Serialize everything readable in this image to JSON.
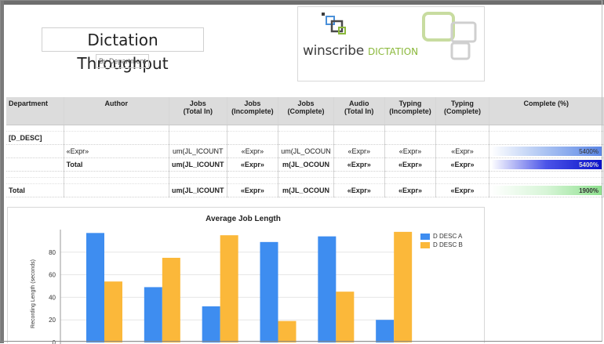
{
  "report": {
    "title": "Dictation Throughput",
    "subtitle": "By Department"
  },
  "logo": {
    "name": "winscribe",
    "tagline": "DICTATION"
  },
  "table": {
    "headers": [
      {
        "l1": "Department",
        "l2": ""
      },
      {
        "l1": "Author",
        "l2": ""
      },
      {
        "l1": "Jobs",
        "l2": "(Total In)"
      },
      {
        "l1": "Jobs",
        "l2": "(Incomplete)"
      },
      {
        "l1": "Jobs",
        "l2": "(Complete)"
      },
      {
        "l1": "Audio",
        "l2": "(Total In)"
      },
      {
        "l1": "Typing",
        "l2": "(Incomplete)"
      },
      {
        "l1": "Typing",
        "l2": "(Complete)"
      },
      {
        "l1": "Complete (%)",
        "l2": ""
      }
    ],
    "group_label": "[D_DESC]",
    "detail_row": [
      "",
      "«Expr»",
      "um(JL_ICOUNT",
      "«Expr»",
      "um(JL_OCOUN",
      "«Expr»",
      "«Expr»",
      "«Expr»",
      "5400%"
    ],
    "subtotal_row": [
      "",
      "Total",
      "um(JL_ICOUNT",
      "«Expr»",
      "m(JL_OCOUN",
      "«Expr»",
      "«Expr»",
      "«Expr»",
      "5400%"
    ],
    "grand_total_row": [
      "Total",
      "",
      "um(JL_ICOUNT",
      "«Expr»",
      "m(JL_OCOUN",
      "«Expr»",
      "«Expr»",
      "«Expr»",
      "1900%"
    ]
  },
  "chart_data": {
    "type": "bar",
    "title": "Average Job Length",
    "ylabel": "Recording Length (seconds)",
    "xlabel": "",
    "ylim": [
      0,
      100
    ],
    "yticks": [
      0,
      20,
      40,
      60,
      80
    ],
    "categories": [
      "",
      "",
      "",
      "",
      "",
      ""
    ],
    "legend_position": "top-right",
    "series": [
      {
        "name": "D DESC A",
        "color": "#3e8df0",
        "values": [
          97,
          49,
          32,
          89,
          94,
          20
        ]
      },
      {
        "name": "D DESC B",
        "color": "#fbb83a",
        "values": [
          54,
          75,
          95,
          19,
          45,
          98
        ]
      }
    ]
  }
}
